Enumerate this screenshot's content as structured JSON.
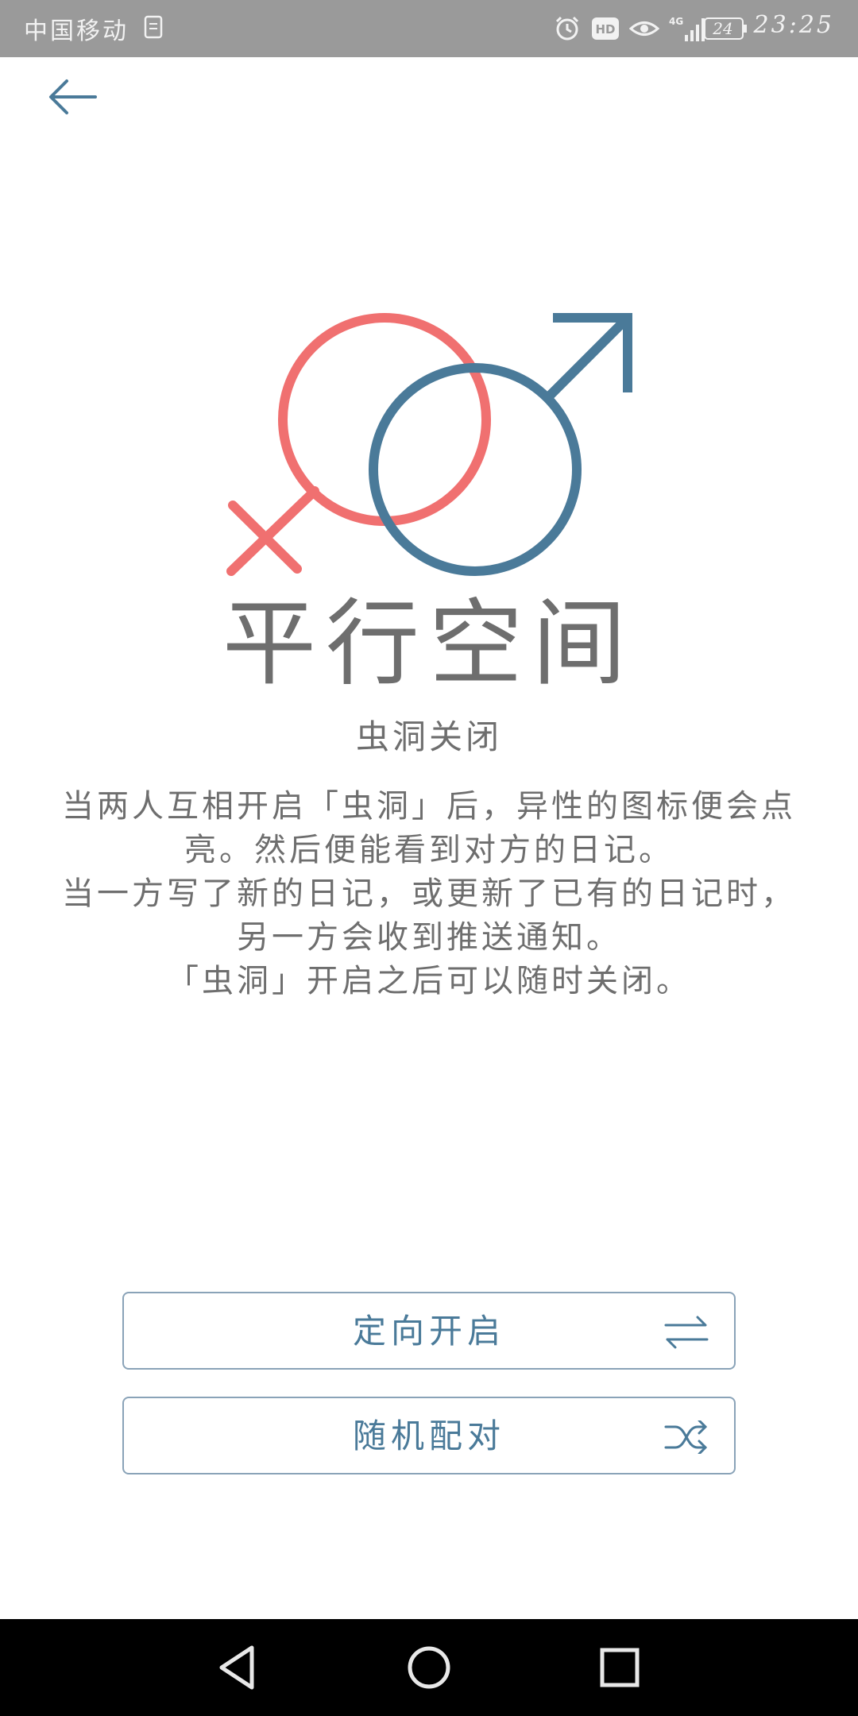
{
  "status_bar": {
    "carrier": "中国移动",
    "network": "4G",
    "hd_label": "HD",
    "battery": "24",
    "time": "23:25"
  },
  "header": {
    "back_icon": "arrow-left-icon"
  },
  "main": {
    "title": "平行空间",
    "subtitle": "虫洞关闭",
    "description": [
      "当两人互相开启「虫洞」后，异性的图标便会点亮。然后便能看到对方的日记。",
      "当一方写了新的日记，或更新了已有的日记时，另一方会收到推送通知。",
      "「虫洞」开启之后可以随时关闭。"
    ]
  },
  "actions": {
    "directed_label": "定向开启",
    "directed_icon": "swap-arrows-icon",
    "random_label": "随机配对",
    "random_icon": "shuffle-icon"
  },
  "colors": {
    "female": "#f07070",
    "male": "#4a7a99",
    "text": "#6e6e6e"
  },
  "nav": {
    "back": "nav-back-icon",
    "home": "nav-home-icon",
    "recents": "nav-recents-icon"
  }
}
